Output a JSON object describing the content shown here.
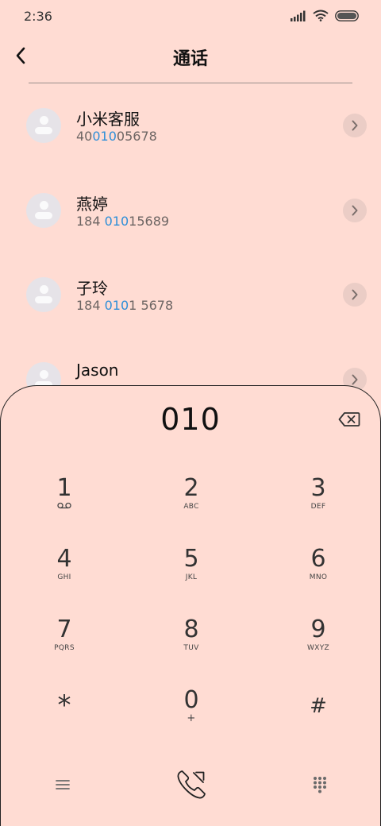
{
  "status_bar": {
    "time": "2:36"
  },
  "header": {
    "title": "通话"
  },
  "contacts": [
    {
      "name": "小米客服",
      "number_pre": "40",
      "number_match": "010",
      "number_post": "05678"
    },
    {
      "name": "燕婷",
      "number_pre": "184 ",
      "number_match": "010",
      "number_post": "15689"
    },
    {
      "name": "子玲",
      "number_pre": "184 ",
      "number_match": "010",
      "number_post": "1 5678"
    },
    {
      "name": "Jason",
      "number_pre": "",
      "number_match": "",
      "number_post": ""
    }
  ],
  "dialer": {
    "input": "010",
    "keys": [
      {
        "digit": "1",
        "letters": ""
      },
      {
        "digit": "2",
        "letters": "ABC"
      },
      {
        "digit": "3",
        "letters": "DEF"
      },
      {
        "digit": "4",
        "letters": "GHI"
      },
      {
        "digit": "5",
        "letters": "JKL"
      },
      {
        "digit": "6",
        "letters": "MNO"
      },
      {
        "digit": "7",
        "letters": "PQRS"
      },
      {
        "digit": "8",
        "letters": "TUV"
      },
      {
        "digit": "9",
        "letters": "WXYZ"
      },
      {
        "digit": "*",
        "letters": ""
      },
      {
        "digit": "0",
        "letters": "+"
      },
      {
        "digit": "#",
        "letters": ""
      }
    ]
  },
  "icons": {
    "back": "back-arrow-icon",
    "chevron": "chevron-right-icon",
    "backspace": "backspace-icon",
    "voicemail": "voicemail-icon",
    "menu": "menu-icon",
    "call": "phone-call-icon",
    "dialpad": "dialpad-icon"
  },
  "colors": {
    "background": "#ffdcd3",
    "match_highlight": "#2f8fd8"
  }
}
